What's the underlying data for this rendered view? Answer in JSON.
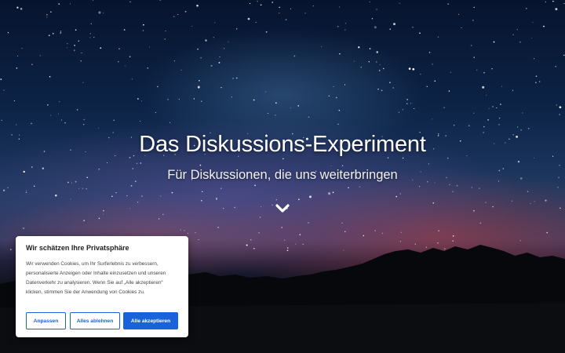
{
  "hero": {
    "title": "Das Diskussions-Experiment",
    "subtitle": "Für Diskussionen, die uns weiterbringen",
    "scroll_icon": "chevron-down-icon"
  },
  "cookie_banner": {
    "title": "Wir schätzen Ihre Privatsphäre",
    "text": "Wir verwenden Cookies, um Ihr Surferlebnis zu verbessern, personalisierte Anzeigen oder Inhalte einzusetzen und unseren Datenverkehr zu analysieren. Wenn Sie auf „Alle akzeptieren“ klicken, stimmen Sie der Anwendung von Cookies zu.",
    "buttons": {
      "customize": "Anpassen",
      "reject_all": "Alles ablehnen",
      "accept_all": "Alle akzeptieren"
    },
    "accent_color": "#1863dc"
  }
}
